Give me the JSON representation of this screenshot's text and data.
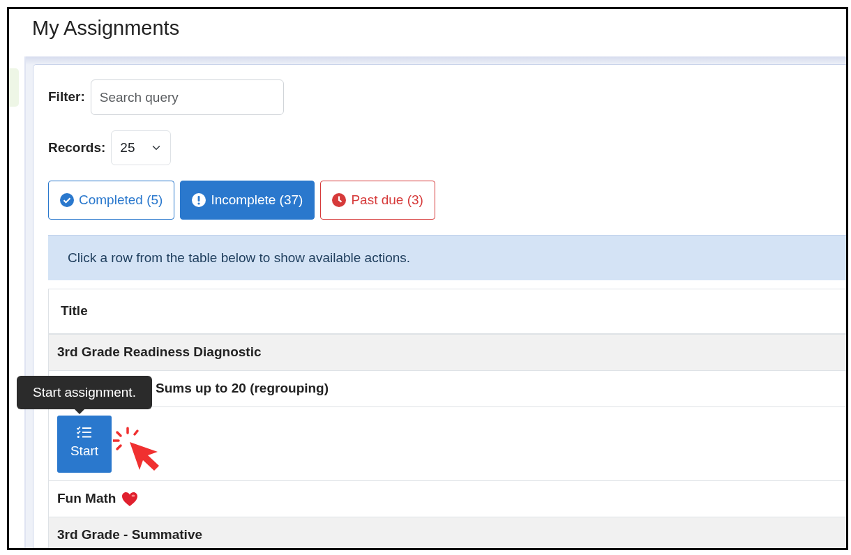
{
  "page": {
    "title": "My Assignments"
  },
  "filter": {
    "label": "Filter:",
    "placeholder": "Search query"
  },
  "records": {
    "label": "Records:",
    "value": "25"
  },
  "status_buttons": [
    {
      "kind": "completed",
      "label": "Completed (5)",
      "selected": false,
      "color": "#2a78cd"
    },
    {
      "kind": "incomplete",
      "label": "Incomplete (37)",
      "selected": true,
      "color": "#2a78cd"
    },
    {
      "kind": "past_due",
      "label": "Past due (3)",
      "selected": false,
      "color": "#d63a3a"
    }
  ],
  "hint": "Click a row from the table below to show available actions.",
  "table": {
    "columns": [
      "Title"
    ],
    "rows": [
      {
        "kind": "assignment",
        "title": "3rd Grade Readiness Diagnostic"
      },
      {
        "kind": "covered",
        "title": "Sums up to 20 (regrouping)"
      },
      {
        "kind": "actions",
        "button": "Start"
      },
      {
        "kind": "emoji",
        "title": "Fun Math"
      },
      {
        "kind": "assignment",
        "title": "3rd Grade - Summative"
      }
    ]
  },
  "tooltip": "Start assignment."
}
